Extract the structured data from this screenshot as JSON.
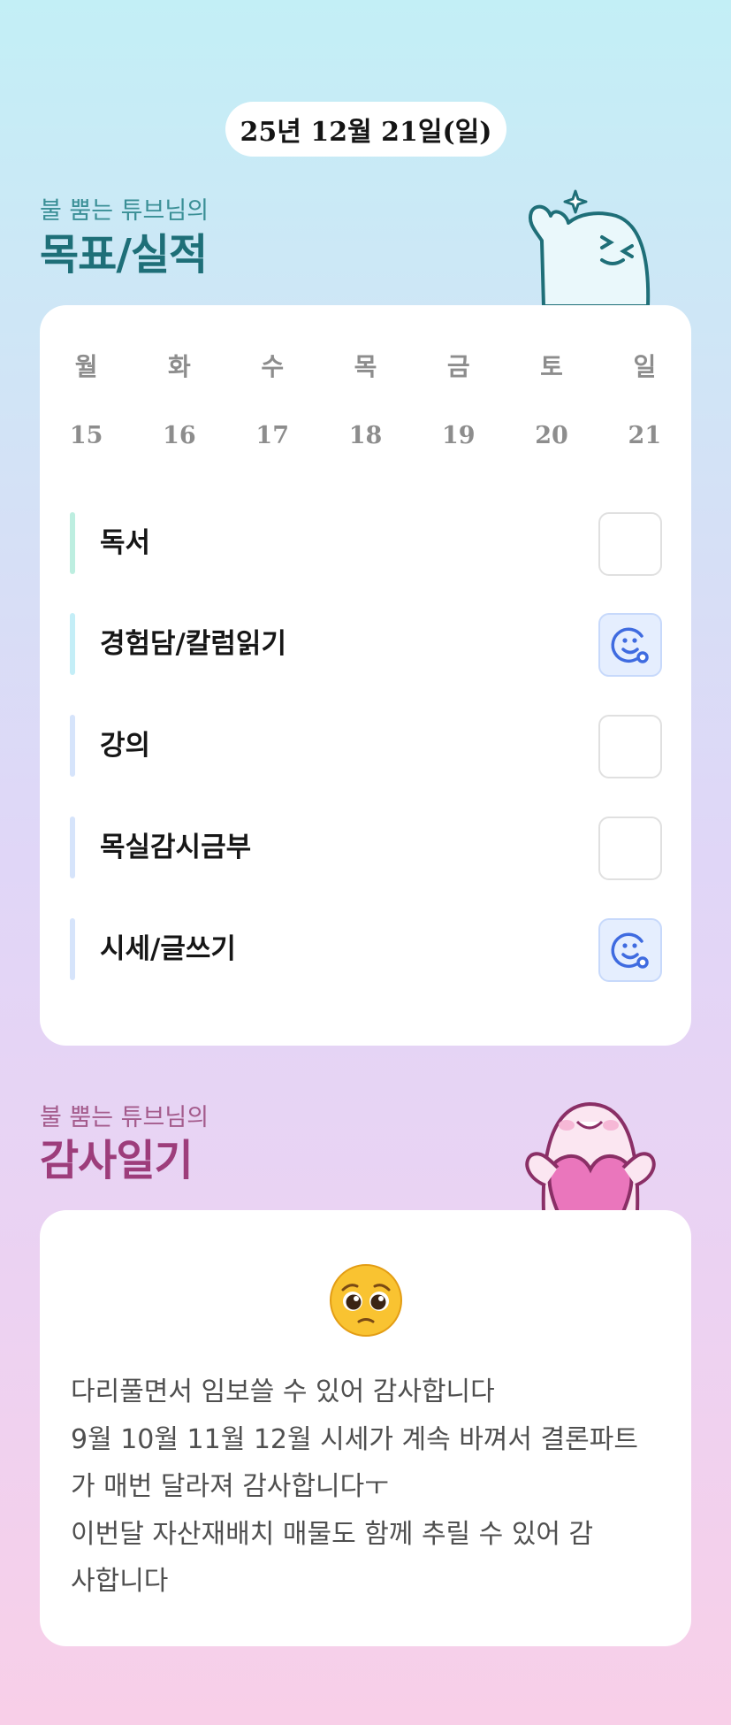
{
  "header": {
    "date": "25년 12월 21일(일)"
  },
  "goals_section": {
    "subtitle": "불 뿜는 튜브님의",
    "title": "목표/실적",
    "weekdays": [
      "월",
      "화",
      "수",
      "목",
      "금",
      "토",
      "일"
    ],
    "dates": [
      "15",
      "16",
      "17",
      "18",
      "19",
      "20",
      "21"
    ],
    "items": [
      {
        "label": "독서",
        "bar_color": "#bdeee0",
        "done": false
      },
      {
        "label": "경험담/칼럼읽기",
        "bar_color": "#c4eef7",
        "done": true
      },
      {
        "label": "강의",
        "bar_color": "#d6e4fb",
        "done": false
      },
      {
        "label": "목실감시금부",
        "bar_color": "#d6e4fb",
        "done": false
      },
      {
        "label": "시세/글쓰기",
        "bar_color": "#d6e4fb",
        "done": true
      }
    ]
  },
  "gratitude_section": {
    "subtitle": "불 뿜는 튜브님의",
    "title": "감사일기",
    "emoji": "pleading-face",
    "lines": [
      "다리풀면서 임보쓸 수 있어 감사합니다",
      "9월 10월 11월 12월 시세가 계속 바껴서 결론파트",
      "가 매번 달라져 감사합니다ㅜ",
      "이번달 자산재배치 매물도 함께 추릴 수 있어 감",
      "사합니다"
    ]
  },
  "colors": {
    "accent_teal": "#1e6f78",
    "accent_pink": "#9d3d7b",
    "done_bg": "#e5eefe",
    "done_icon": "#3f6be0"
  }
}
